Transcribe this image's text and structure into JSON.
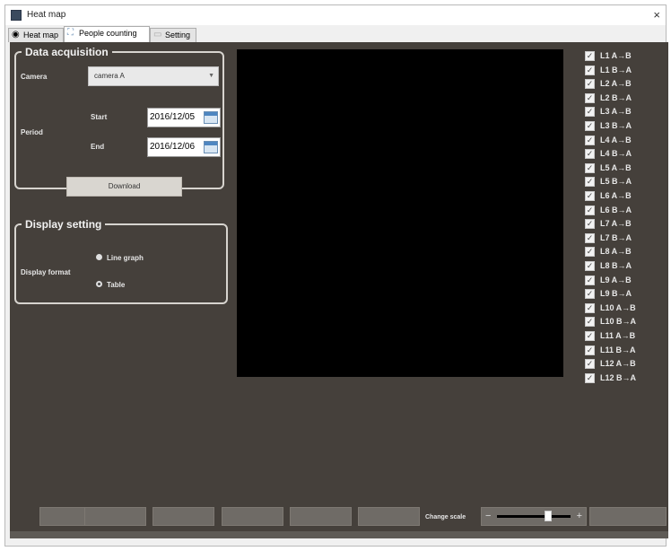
{
  "window": {
    "title": "Heat map",
    "close_glyph": "×"
  },
  "tabs": [
    {
      "label": "Heat map",
      "icon": "heatmap-icon"
    },
    {
      "label": "People counting",
      "icon": "people-counting-icon"
    },
    {
      "label": "Setting",
      "icon": "setting-icon"
    }
  ],
  "data_acquisition": {
    "legend": "Data acquisition",
    "camera_label": "Camera",
    "camera_value": "camera A",
    "period_label": "Period",
    "start_label": "Start",
    "start_value": "2016/12/05",
    "end_label": "End",
    "end_value": "2016/12/06",
    "download_label": "Download"
  },
  "display_setting": {
    "legend": "Display setting",
    "format_label": "Display format",
    "options": [
      "Line graph",
      "Table"
    ],
    "selected": "Table"
  },
  "lines": [
    {
      "label": "L1  A→B",
      "checked": true
    },
    {
      "label": "L1  B→A",
      "checked": true
    },
    {
      "label": "L2  A→B",
      "checked": true
    },
    {
      "label": "L2  B→A",
      "checked": true
    },
    {
      "label": "L3  A→B",
      "checked": true
    },
    {
      "label": "L3  B→A",
      "checked": true
    },
    {
      "label": "L4  A→B",
      "checked": true
    },
    {
      "label": "L4  B→A",
      "checked": true
    },
    {
      "label": "L5  A→B",
      "checked": true
    },
    {
      "label": "L5  B→A",
      "checked": true
    },
    {
      "label": "L6  A→B",
      "checked": true
    },
    {
      "label": "L6  B→A",
      "checked": true
    },
    {
      "label": "L7  A→B",
      "checked": true
    },
    {
      "label": "L7  B→A",
      "checked": true
    },
    {
      "label": "L8  A→B",
      "checked": true
    },
    {
      "label": "L8  B→A",
      "checked": true
    },
    {
      "label": "L9  A→B",
      "checked": true
    },
    {
      "label": "L9  B→A",
      "checked": true
    },
    {
      "label": "L10 A→B",
      "checked": true
    },
    {
      "label": "L10 B→A",
      "checked": true
    },
    {
      "label": "L11 A→B",
      "checked": true
    },
    {
      "label": "L11 B→A",
      "checked": true
    },
    {
      "label": "L12 A→B",
      "checked": true
    },
    {
      "label": "L12 B→A",
      "checked": true
    }
  ],
  "bottom": {
    "change_scale_label": "Change scale",
    "scale_minus": "−",
    "scale_plus": "+"
  },
  "colors": {
    "panel_bg": "#45403b",
    "graph_bg": "#000000",
    "groupbox_border": "#d7d4cf"
  }
}
